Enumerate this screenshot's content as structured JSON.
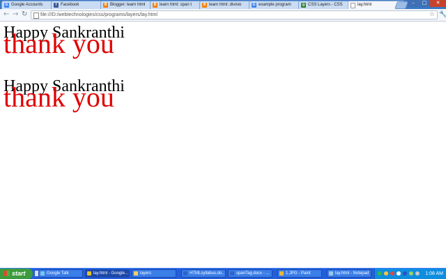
{
  "browser": {
    "tabs": [
      {
        "label": "Google Accounts",
        "favicon": "google-icon",
        "color": "#4285f4"
      },
      {
        "label": "Facebook",
        "favicon": "facebook-icon",
        "color": "#3b5998"
      },
      {
        "label": "Blogger: learn html",
        "favicon": "blogger-icon",
        "color": "#f57d00"
      },
      {
        "label": "learn html: span t",
        "favicon": "blogger-icon",
        "color": "#f57d00"
      },
      {
        "label": "learn html: divisio",
        "favicon": "blogger-icon",
        "color": "#f57d00"
      },
      {
        "label": "example program",
        "favicon": "google-icon",
        "color": "#4285f4"
      },
      {
        "label": "CSS Layers - CSS",
        "favicon": "web-icon",
        "color": "#2b7d2b"
      },
      {
        "label": "lay.html",
        "favicon": "page-icon",
        "color": "#cfd8e3",
        "active": true
      }
    ],
    "close_glyph": "×",
    "url": "file:///D:/webtechnologies/css/programs/layers/lay.html",
    "back_glyph": "←",
    "forward_glyph": "→",
    "reload_glyph": "↻",
    "star_glyph": "☆",
    "wrench_glyph": "🔧",
    "min_glyph": "–",
    "max_glyph": "□",
    "winclose_glyph": "✕"
  },
  "page": {
    "block1": {
      "happy": "Happy Sankranthi",
      "thanks": "thank you"
    },
    "block2": {
      "happy": "Happy Sankranthi",
      "thanks": "thank you"
    }
  },
  "taskbar": {
    "start_label": "start",
    "tasks": [
      {
        "label": "Google Talk",
        "icon": "talk-icon",
        "color": "#7cc3ef"
      },
      {
        "label": "lay.html - Google...",
        "icon": "chrome-icon",
        "color": "#e6c12a",
        "active": true
      },
      {
        "label": "layers",
        "icon": "folder-icon",
        "color": "#f0cf6b"
      },
      {
        "label": "HTMLsyllabus.do...",
        "icon": "word-icon",
        "color": "#2e65c7"
      },
      {
        "label": "spanTag.docx - ...",
        "icon": "word-icon",
        "color": "#2e65c7"
      },
      {
        "label": "1.JPG - Paint",
        "icon": "paint-icon",
        "color": "#e9b73c"
      },
      {
        "label": "lay.html - Notepad",
        "icon": "notepad-icon",
        "color": "#9dc5e8"
      }
    ],
    "clock": "1:08 AM"
  }
}
